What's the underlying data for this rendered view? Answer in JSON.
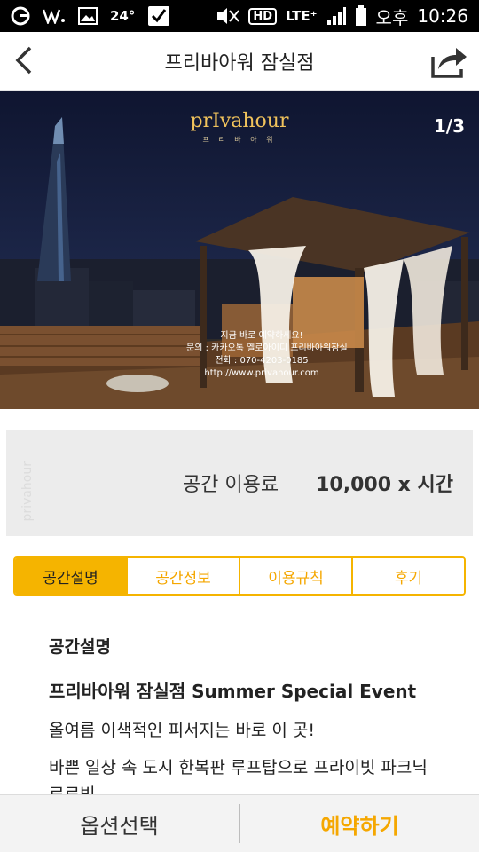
{
  "status_bar": {
    "temperature": "24°",
    "hd": "HD",
    "network": "LTE⁺",
    "ampm": "오후",
    "time": "10:26"
  },
  "header": {
    "title": "프리바아워 잠실점",
    "back_icon": "chevron-left-icon",
    "share_icon": "share-icon"
  },
  "hero": {
    "counter": "1/3",
    "brand": "prIvahour",
    "brand_sub": "프 리 바 아 워",
    "caption_lines": [
      "지금 바로 예약하세요!",
      "문의 : 카카오톡 옐로아이디 프리바아워잠실",
      "전화 : 070-4203-0185",
      "http://www.privahour.com"
    ]
  },
  "price": {
    "watermark": "privahour",
    "label": "공간 이용료",
    "value": "10,000 x 시간"
  },
  "tabs": [
    {
      "label": "공간설명",
      "active": true
    },
    {
      "label": "공간정보",
      "active": false
    },
    {
      "label": "이용규칙",
      "active": false
    },
    {
      "label": "후기",
      "active": false
    }
  ],
  "content": {
    "heading": "공간설명",
    "subtitle": "프리바아워 잠실점 Summer Special Event",
    "para1": "올여름 이색적인 피서지는 바로 이 곳!",
    "para2": "바쁜 일상 속 도시 한복판 루프탑으로 프라이빗 파크닉 르르빈"
  },
  "bottom": {
    "option_label": "옵션선택",
    "reserve_label": "예약하기"
  },
  "colors": {
    "accent": "#f5b400",
    "accent_text": "#f5a700"
  }
}
